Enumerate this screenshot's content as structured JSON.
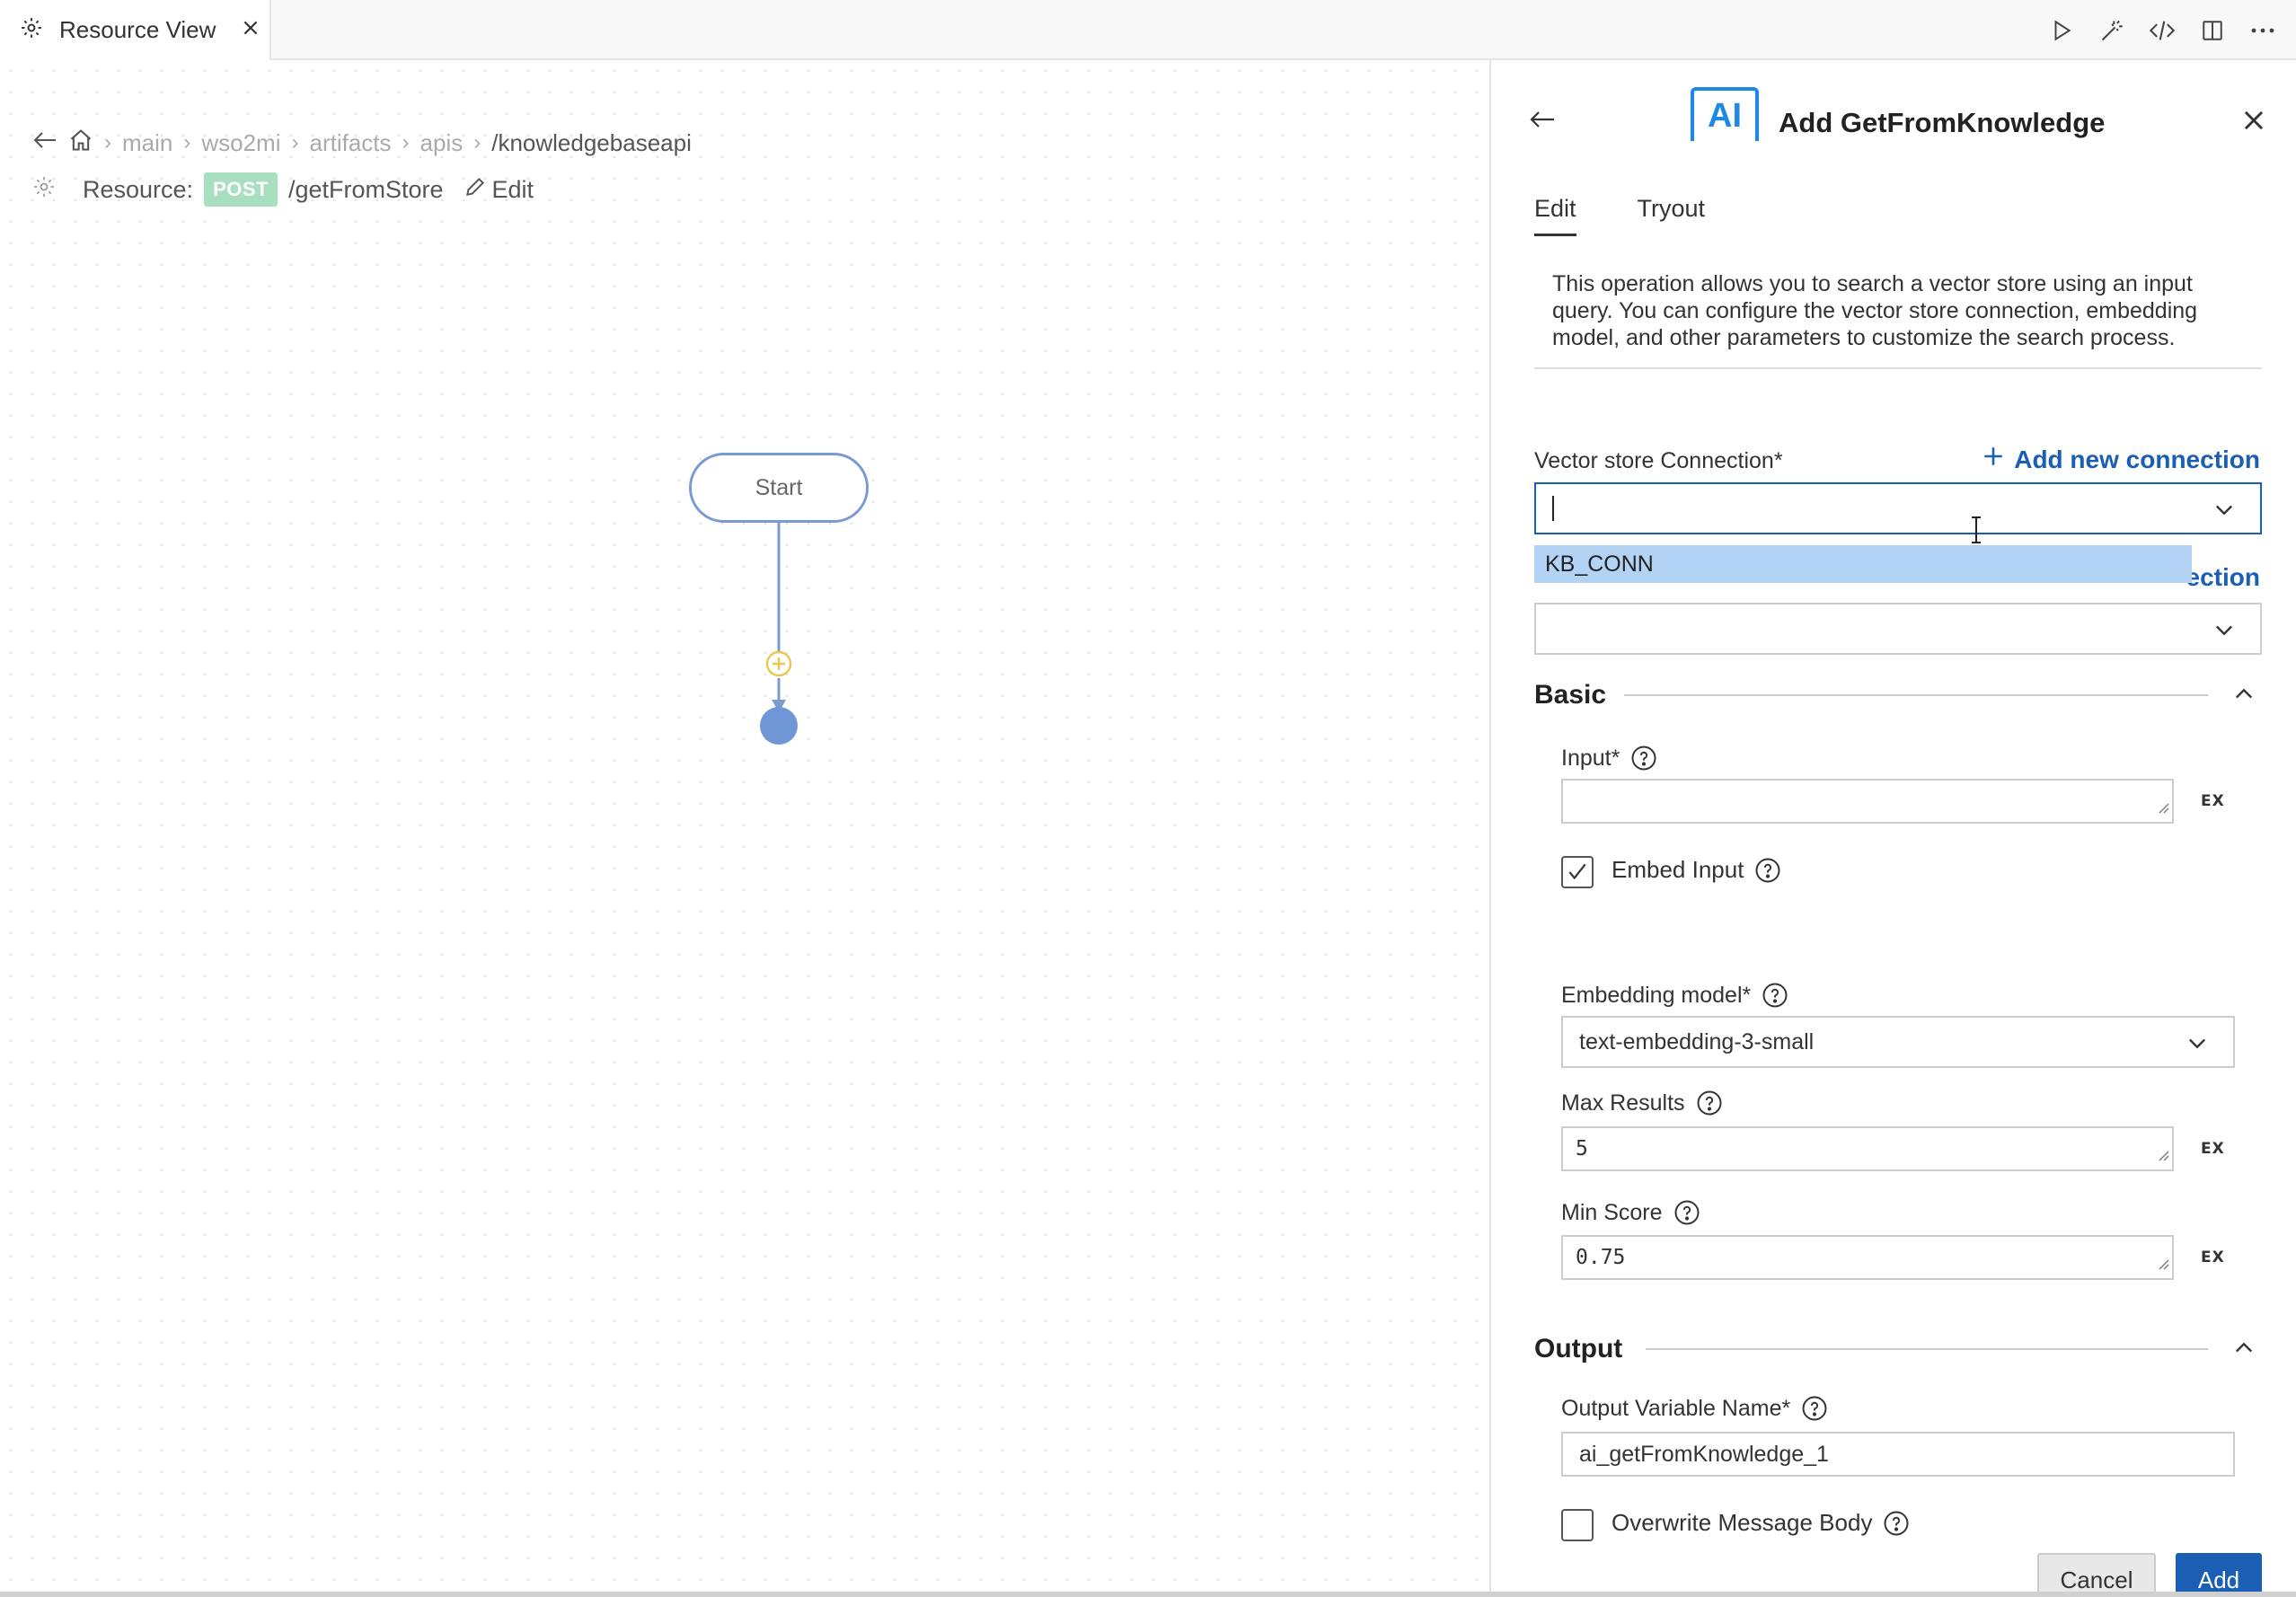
{
  "tab": {
    "label": "Resource View",
    "icon": "gear-icon"
  },
  "breadcrumb": {
    "items": [
      "main",
      "wso2mi",
      "artifacts",
      "apis",
      "/knowledgebaseapi"
    ]
  },
  "resource": {
    "label": "Resource:",
    "method": "POST",
    "path": "/getFromStore",
    "edit_label": "Edit"
  },
  "diagram": {
    "start_label": "Start"
  },
  "panel": {
    "title": "Add GetFromKnowledge",
    "logo_text": "AI",
    "tabs": [
      {
        "label": "Edit",
        "active": true
      },
      {
        "label": "Tryout",
        "active": false
      }
    ],
    "description": "This operation allows you to search a vector store using an input query. You can configure the vector store connection, embedding model, and other parameters to customize the search process.",
    "vector_store": {
      "label": "Vector store Connection*",
      "add_label": "Add new connection",
      "value": "",
      "option": "KB_CONN"
    },
    "second_connection": {
      "add_label_partial": "ection",
      "value": ""
    },
    "basic": {
      "title": "Basic",
      "input_label": "Input*",
      "input_value": "",
      "ex_label": "EX",
      "embed_input_label": "Embed Input",
      "embed_input_checked": true,
      "embedding_model_label": "Embedding model*",
      "embedding_model_value": "text-embedding-3-small",
      "max_results_label": "Max Results",
      "max_results_value": "5",
      "min_score_label": "Min Score",
      "min_score_value": "0.75"
    },
    "output": {
      "title": "Output",
      "variable_label": "Output Variable Name*",
      "variable_value": "ai_getFromKnowledge_1",
      "overwrite_label": "Overwrite Message Body",
      "overwrite_checked": false
    },
    "buttons": {
      "cancel": "Cancel",
      "add": "Add"
    }
  },
  "colors": {
    "accent": "#1a5fb4",
    "post_badge": "#a8dfc0",
    "flow_line": "#7a9bd2",
    "dropdown_highlight": "#b3d3f5",
    "add_point": "#e8c84a"
  }
}
